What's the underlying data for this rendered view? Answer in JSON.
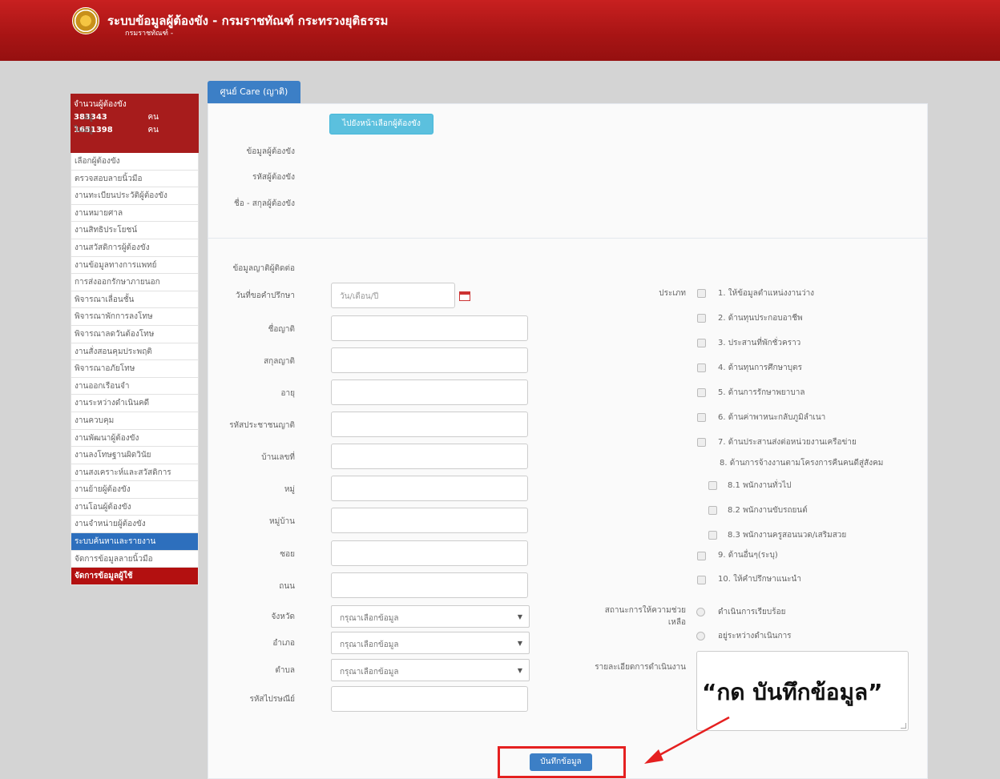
{
  "header": {
    "title": "ระบบข้อมูลผู้ต้องขัง - กรมราชทัณฑ์ กระทรวงยุติธรรม",
    "subtitle": "กรมราชทัณฑ์ -"
  },
  "sidebar": {
    "stats_title": "จำนวนผู้ต้องขัง",
    "present_label": "อยู่",
    "present_count": "383343",
    "absent_label": "ไม่อยู่",
    "absent_count": "1651398",
    "unit": "คน",
    "items": [
      {
        "label": "เลือกผู้ต้องขัง"
      },
      {
        "label": "ตรวจสอบลายนิ้วมือ"
      },
      {
        "label": "งานทะเบียนประวัติผู้ต้องขัง"
      },
      {
        "label": "งานหมายศาล"
      },
      {
        "label": "งานสิทธิประโยชน์"
      },
      {
        "label": "งานสวัสดิการผู้ต้องขัง"
      },
      {
        "label": "งานข้อมูลทางการแพทย์"
      },
      {
        "label": "การส่งออกรักษาภายนอก"
      },
      {
        "label": "พิจารณาเลื่อนชั้น"
      },
      {
        "label": "พิจารณาพักการลงโทษ"
      },
      {
        "label": "พิจารณาลดวันต้องโทษ"
      },
      {
        "label": "งานสั่งสอนคุมประพฤติ"
      },
      {
        "label": "พิจารณาอภัยโทษ"
      },
      {
        "label": "งานออกเรือนจำ"
      },
      {
        "label": "งานระหว่างดำเนินคดี"
      },
      {
        "label": "งานควบคุม"
      },
      {
        "label": "งานพัฒนาผู้ต้องขัง"
      },
      {
        "label": "งานลงโทษฐานผิดวินัย"
      },
      {
        "label": "งานสงเคราะห์และสวัสดิการ"
      },
      {
        "label": "งานย้ายผู้ต้องขัง"
      },
      {
        "label": "งานโอนผู้ต้องขัง"
      },
      {
        "label": "งานจำหน่ายผู้ต้องขัง"
      },
      {
        "label": "ระบบค้นหาและรายงาน"
      },
      {
        "label": "จัดการข้อมูลลายนิ้วมือ"
      },
      {
        "label": "จัดการข้อมูลผู้ใช้"
      }
    ]
  },
  "tab": {
    "label": "ศูนย์ Care (ญาติ)"
  },
  "top": {
    "goto_button": "ไปยังหน้าเลือกผู้ต้องขัง",
    "labels": [
      "ข้อมูลผู้ต้องขัง",
      "รหัสผู้ต้องขัง",
      "ชื่อ - สกุลผู้ต้องขัง"
    ]
  },
  "form": {
    "section_title": "ข้อมูลญาติผู้ติดต่อ",
    "date_label": "วันที่ขอคำปรึกษา",
    "date_placeholder": "วัน/เดือน/ปี",
    "fields": [
      {
        "label": "ชื่อญาติ"
      },
      {
        "label": "สกุลญาติ"
      },
      {
        "label": "อายุ"
      },
      {
        "label": "รหัสประชาชนญาติ"
      },
      {
        "label": "บ้านเลขที่"
      },
      {
        "label": "หมู่"
      },
      {
        "label": "หมู่บ้าน"
      },
      {
        "label": "ซอย"
      },
      {
        "label": "ถนน"
      }
    ],
    "province_label": "จังหวัด",
    "district_label": "อำเภอ",
    "subdistrict_label": "ตำบล",
    "select_placeholder": "กรุณาเลือกข้อมูล",
    "postcode_label": "รหัสไปรษณีย์"
  },
  "right": {
    "type_label": "ประเภท",
    "options": [
      "1. ให้ข้อมูลตำแหน่งงานว่าง",
      "2. ด้านทุนประกอบอาชีพ",
      "3. ประสานที่พักชั่วคราว",
      "4. ด้านทุนการศึกษาบุตร",
      "5. ด้านการรักษาพยาบาล",
      "6. ด้านค่าพาหนะกลับภูมิลำเนา",
      "7. ด้านประสานส่งต่อหน่วยงานเครือข่าย"
    ],
    "option8_header": "8. ด้านการจ้างงานตามโครงการคืนคนดีสู่สังคม",
    "sub_options": [
      "8.1 พนักงานทั่วไป",
      "8.2 พนักงานขับรถยนต์",
      "8.3 พนักงานครูสอนนวด/เสริมสวย"
    ],
    "option9": "9. ด้านอื่นๆ(ระบุ)",
    "option10": "10. ให้คำปรึกษาแนะนำ",
    "status_label_1": "สถานะการให้ความช่วย",
    "status_label_2": "เหลือ",
    "status_options": [
      "ดำเนินการเรียบร้อย",
      "อยู่ระหว่างดำเนินการ"
    ],
    "detail_label": "รายละเอียดการดำเนินงาน"
  },
  "save_button": "บันทึกข้อมูล",
  "annotation": "“กด บันทึกข้อมูล”",
  "colors": {
    "header": "#a71414",
    "accent": "#3c7fc6",
    "highlight": "#e52020"
  }
}
